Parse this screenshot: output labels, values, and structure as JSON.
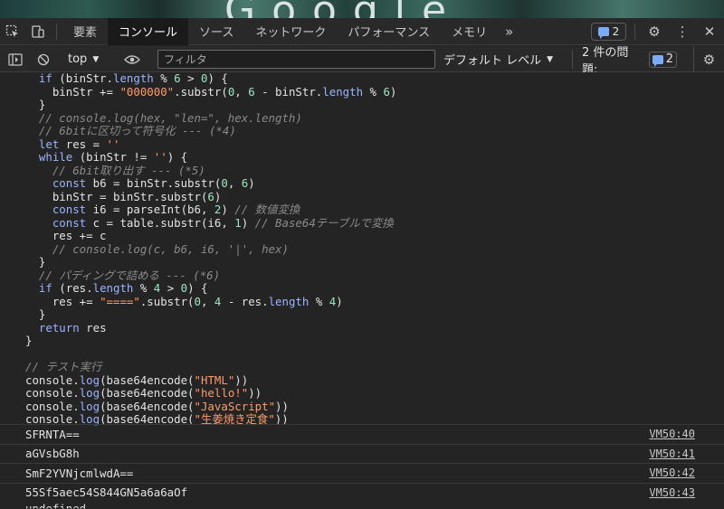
{
  "tabs": [
    "要素",
    "コンソール",
    "ソース",
    "ネットワーク",
    "パフォーマンス",
    "メモリ"
  ],
  "active_tab": "コンソール",
  "more_tabs": "»",
  "issues_badge_count": "2",
  "console_toolbar": {
    "context": "top",
    "filter_placeholder": "フィルタ",
    "level": "デフォルト レベル",
    "issues_label": "2 件の問題:",
    "issues_count": "2"
  },
  "code_lines": [
    "  if (binStr.length % 6 > 0) {",
    "    binStr += \"000000\".substr(0, 6 - binStr.length % 6)",
    "  }",
    "  // console.log(hex, \"len=\", hex.length)",
    "  // 6bitに区切って符号化 --- (*4)",
    "  let res = ''",
    "  while (binStr != '') {",
    "    // 6bit取り出す --- (*5)",
    "    const b6 = binStr.substr(0, 6)",
    "    binStr = binStr.substr(6)",
    "    const i6 = parseInt(b6, 2) // 数値変換",
    "    const c = table.substr(i6, 1) // Base64テーブルで変換",
    "    res += c",
    "    // console.log(c, b6, i6, '|', hex)",
    "  }",
    "  // パディングで詰める --- (*6)",
    "  if (res.length % 4 > 0) {",
    "    res += \"====\".substr(0, 4 - res.length % 4)",
    "  }",
    "  return res",
    "}",
    "",
    "// テスト実行",
    "console.log(base64encode(\"HTML\"))",
    "console.log(base64encode(\"hello!\"))",
    "console.log(base64encode(\"JavaScript\"))",
    "console.log(base64encode(\"生姜焼き定食\"))"
  ],
  "outputs": [
    {
      "value": "SFRNTA==",
      "source": "VM50:40"
    },
    {
      "value": "aGVsbG8h",
      "source": "VM50:41"
    },
    {
      "value": "SmF2YVNjcmlwdA==",
      "source": "VM50:42"
    },
    {
      "value": "55Sf5aec54S844GN5a6a6aOf",
      "source": "VM50:43"
    }
  ],
  "partial_line": "undefined"
}
